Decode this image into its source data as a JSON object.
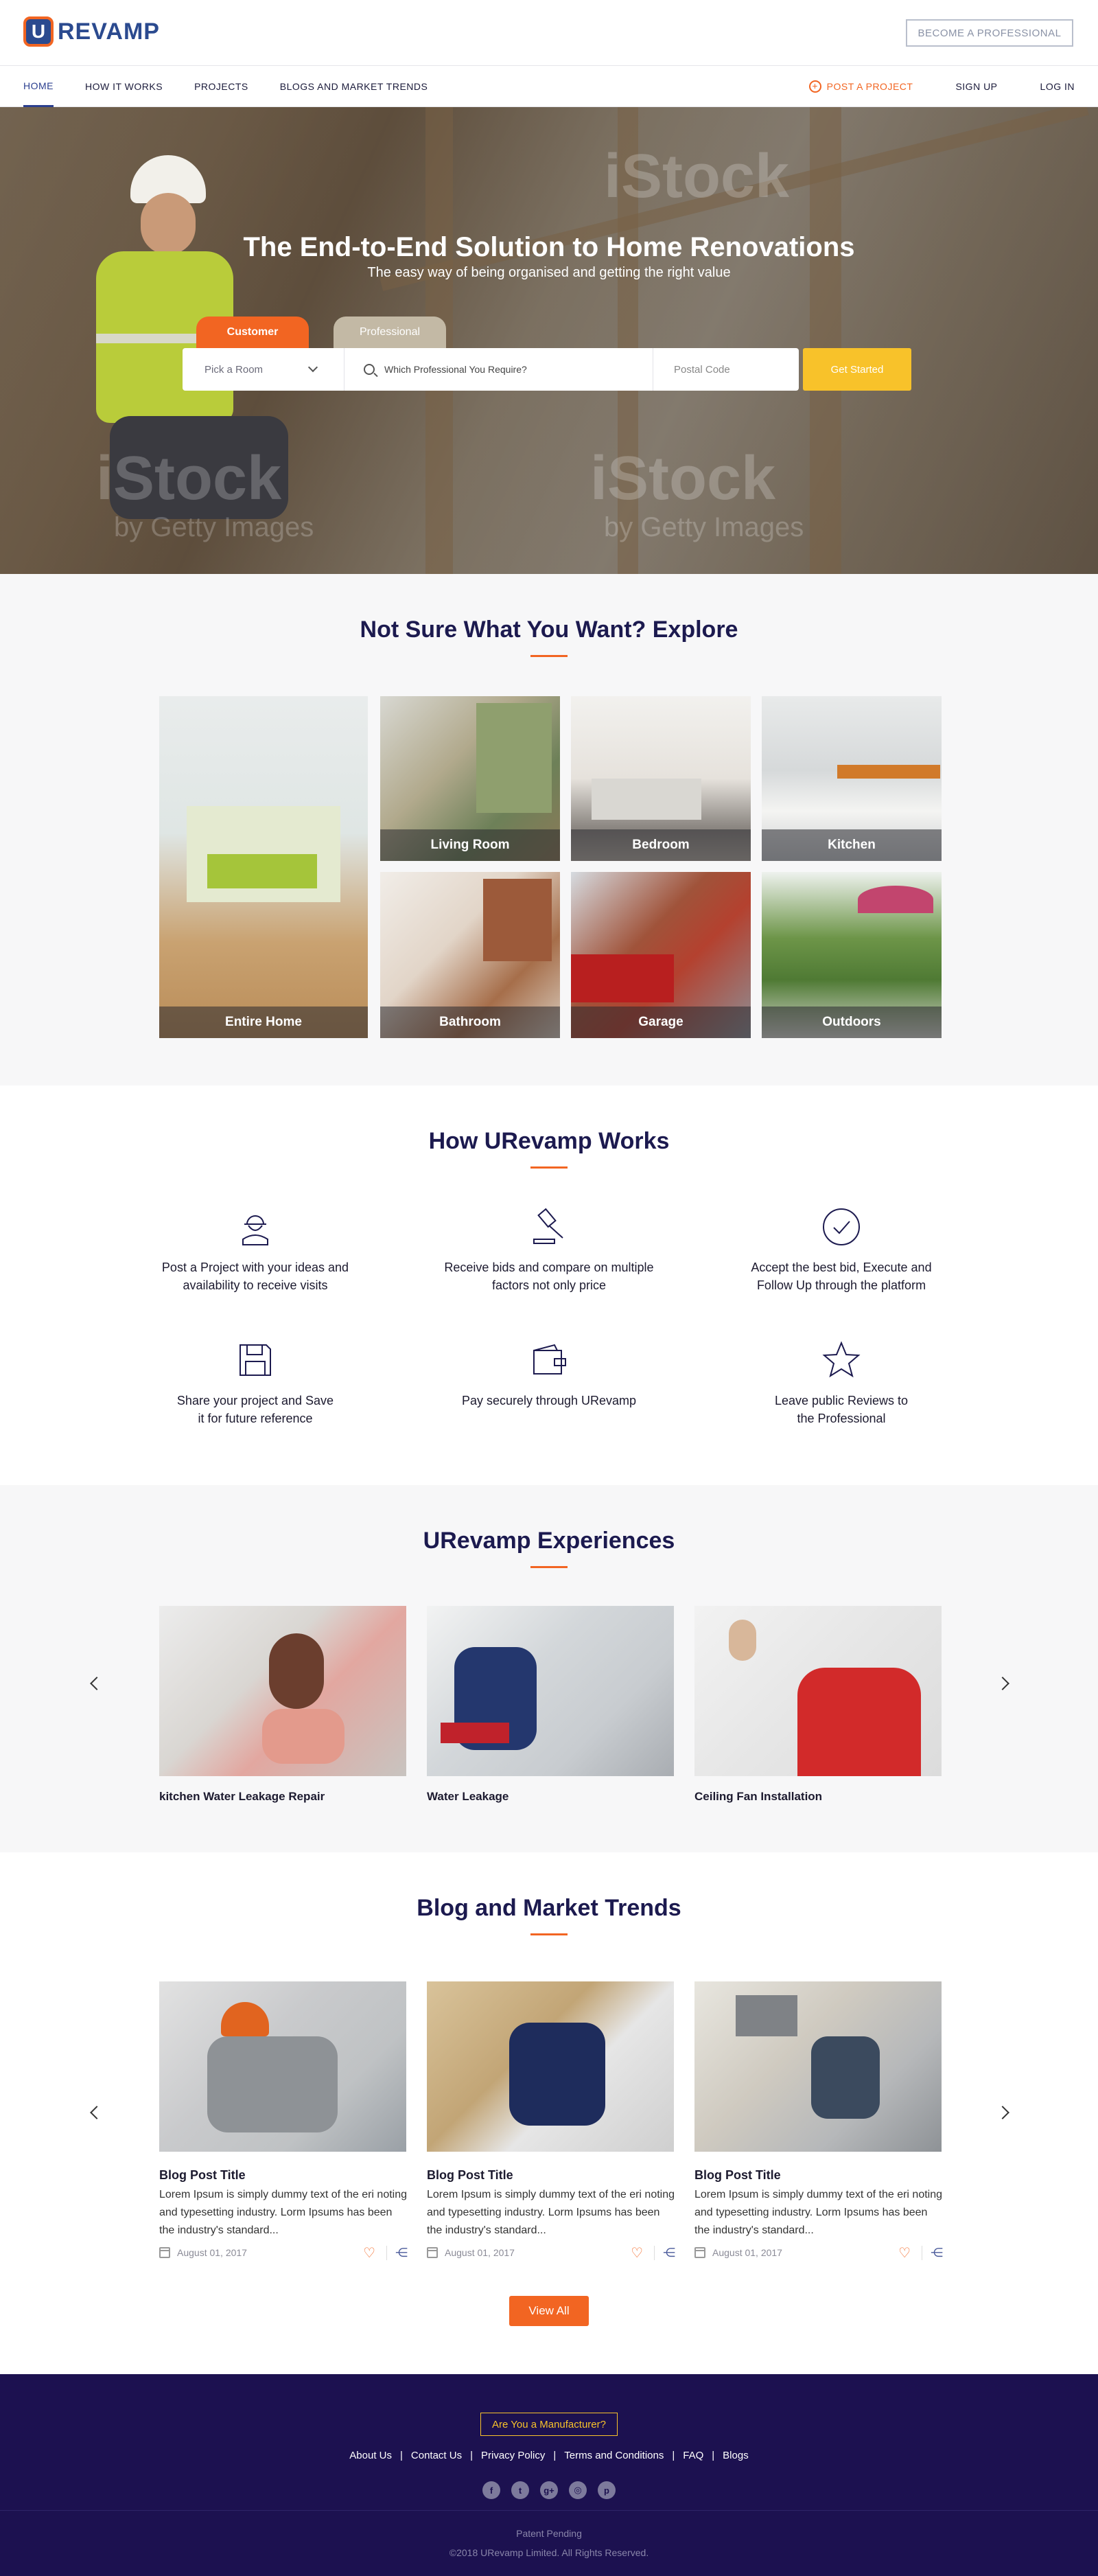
{
  "brand": {
    "logo_letter": "U",
    "logo_text": "REVAMP",
    "primary_color": "#2b4a8f",
    "accent_color": "#f26522",
    "cta_color": "#f8c22a",
    "footer_color": "#1c1150"
  },
  "header": {
    "become_professional": "BECOME A PROFESSIONAL"
  },
  "nav": {
    "items": [
      {
        "label": "HOME",
        "active": true
      },
      {
        "label": "HOW IT WORKS",
        "active": false
      },
      {
        "label": "PROJECTS",
        "active": false
      },
      {
        "label": "BLOGS AND MARKET TRENDS",
        "active": false
      }
    ],
    "post_project": "POST A PROJECT",
    "sign_up": "SIGN UP",
    "log_in": "LOG IN"
  },
  "hero": {
    "title": "The End-to-End Solution to Home Renovations",
    "subtitle": "The easy way of being organised and getting the right value",
    "watermark_big": "iStock",
    "watermark_small": "by Getty Images",
    "tabs": {
      "customer": "Customer",
      "professional": "Professional"
    },
    "search": {
      "room_placeholder": "Pick a Room",
      "professional_placeholder": "Which Professional You Require?",
      "postal_placeholder": "Postal Code",
      "cta": "Get Started"
    }
  },
  "explore": {
    "title": "Not Sure What You Want? Explore",
    "tiles": [
      {
        "label": "Entire Home"
      },
      {
        "label": "Living Room"
      },
      {
        "label": "Bedroom"
      },
      {
        "label": "Kitchen"
      },
      {
        "label": "Bathroom"
      },
      {
        "label": "Garage"
      },
      {
        "label": "Outdoors"
      }
    ]
  },
  "how": {
    "title": "How URevamp Works",
    "steps": [
      {
        "icon": "worker-icon",
        "line1": "Post a Project with your ideas and",
        "line2": "availability to receive visits"
      },
      {
        "icon": "gavel-icon",
        "line1": "Receive bids and compare on multiple",
        "line2": "factors not only price"
      },
      {
        "icon": "check-circle-icon",
        "line1": "Accept the best bid, Execute and",
        "line2": "Follow Up through the platform"
      },
      {
        "icon": "floppy-disk-icon",
        "line1": "Share your project and Save",
        "line2": "it for future reference"
      },
      {
        "icon": "wallet-icon",
        "line1": "Pay securely through URevamp",
        "line2": ""
      },
      {
        "icon": "star-icon",
        "line1": "Leave public Reviews to",
        "line2": "the Professional"
      }
    ]
  },
  "experiences": {
    "title": "URevamp Experiences",
    "cards": [
      {
        "caption": "kitchen Water Leakage Repair"
      },
      {
        "caption": "Water Leakage"
      },
      {
        "caption": "Ceiling Fan Installation"
      }
    ]
  },
  "blog": {
    "title": "Blog and Market Trends",
    "posts": [
      {
        "title": "Blog Post Title",
        "excerpt": "Lorem Ipsum is simply dummy text of the eri noting and typesetting industry. Lorm Ipsums has been the industry's standard...",
        "date": "August 01, 2017"
      },
      {
        "title": "Blog Post Title",
        "excerpt": "Lorem Ipsum is simply dummy text of the eri noting and typesetting industry. Lorm Ipsums has been the industry's standard...",
        "date": "August 01, 2017"
      },
      {
        "title": "Blog Post Title",
        "excerpt": "Lorem Ipsum is simply dummy text of the eri noting and typesetting industry. Lorm Ipsums has been the industry's standard...",
        "date": "August 01, 2017"
      }
    ],
    "view_all": "View All"
  },
  "footer": {
    "manufacturer": "Are You a Manufacturer?",
    "links": [
      "About Us",
      "Contact Us",
      "Privacy Policy",
      "Terms and Conditions",
      "FAQ",
      "Blogs"
    ],
    "separator": "|",
    "social": [
      {
        "icon": "facebook-icon",
        "glyph": "f"
      },
      {
        "icon": "twitter-icon",
        "glyph": "t"
      },
      {
        "icon": "google-plus-icon",
        "glyph": "g+"
      },
      {
        "icon": "instagram-icon",
        "glyph": "◎"
      },
      {
        "icon": "pinterest-icon",
        "glyph": "p"
      }
    ],
    "patent": "Patent Pending",
    "copyright": "©2018 URevamp Limited. All Rights Reserved."
  }
}
